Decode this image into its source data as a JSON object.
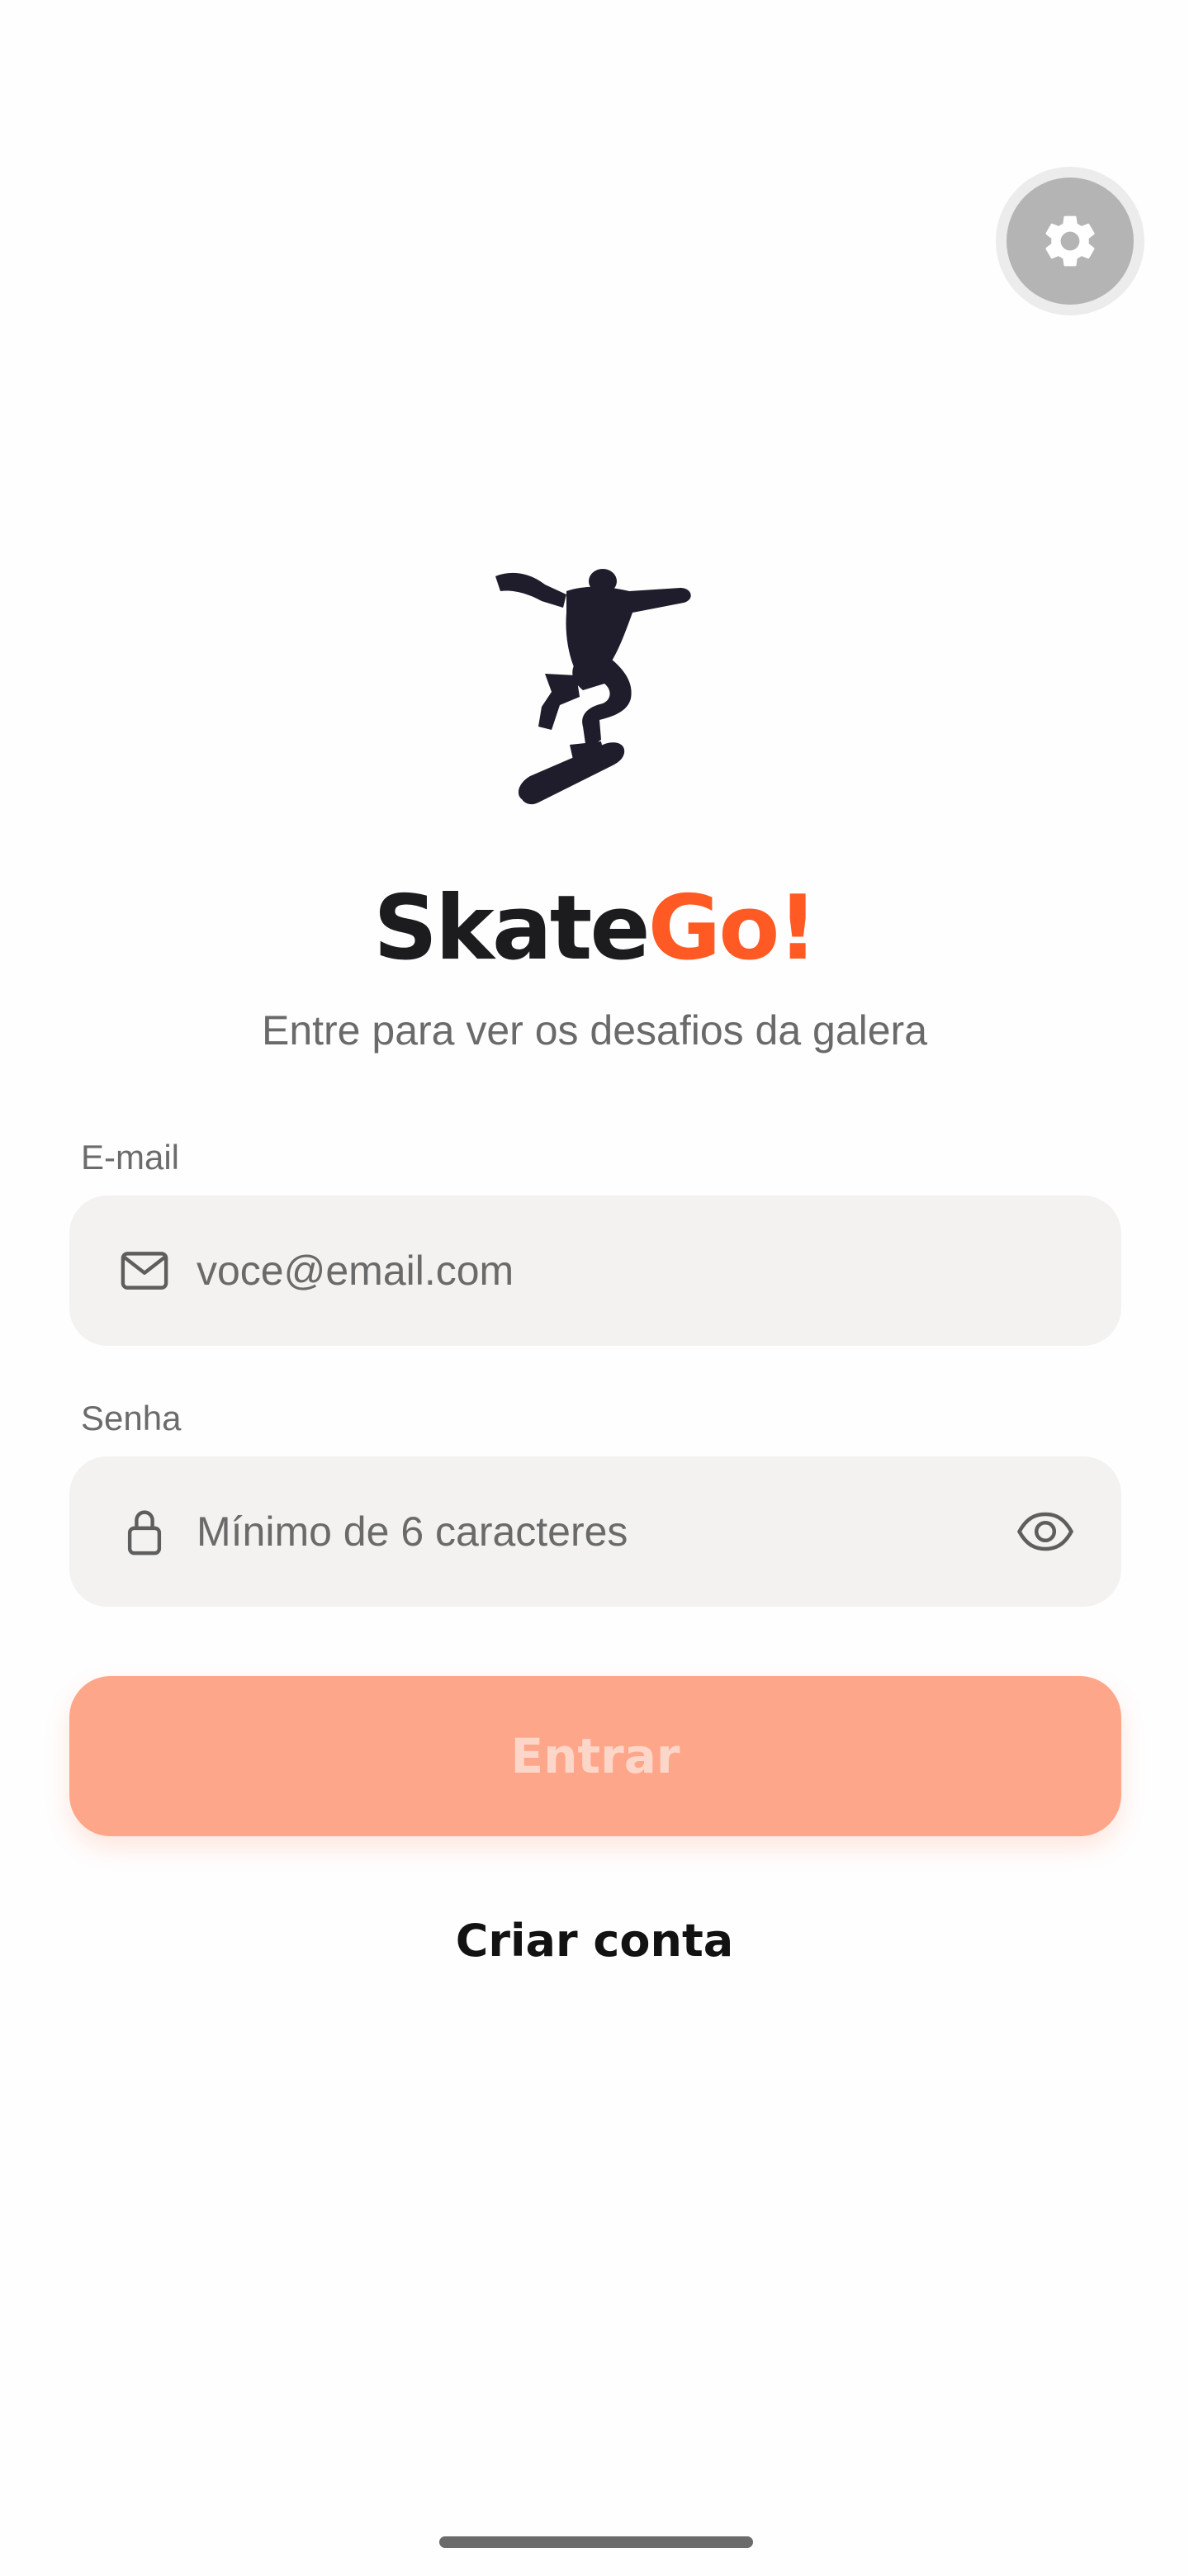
{
  "app": {
    "brand_part1": "Skate",
    "brand_part2": "Go!",
    "subtitle": "Entre para ver os desafios da galera",
    "accent_color": "#ff5a24"
  },
  "settings": {
    "icon": "gear-icon"
  },
  "logo": {
    "icon": "skateboarder-silhouette"
  },
  "email": {
    "label": "E-mail",
    "placeholder": "voce@email.com",
    "value": "",
    "icon": "mail-icon"
  },
  "password": {
    "label": "Senha",
    "placeholder": "Mínimo de 6 caracteres",
    "value": "",
    "icon": "lock-icon",
    "toggle_icon": "eye-icon"
  },
  "actions": {
    "login_label": "Entrar",
    "create_account_label": "Criar conta",
    "login_color": "#fea68a"
  }
}
